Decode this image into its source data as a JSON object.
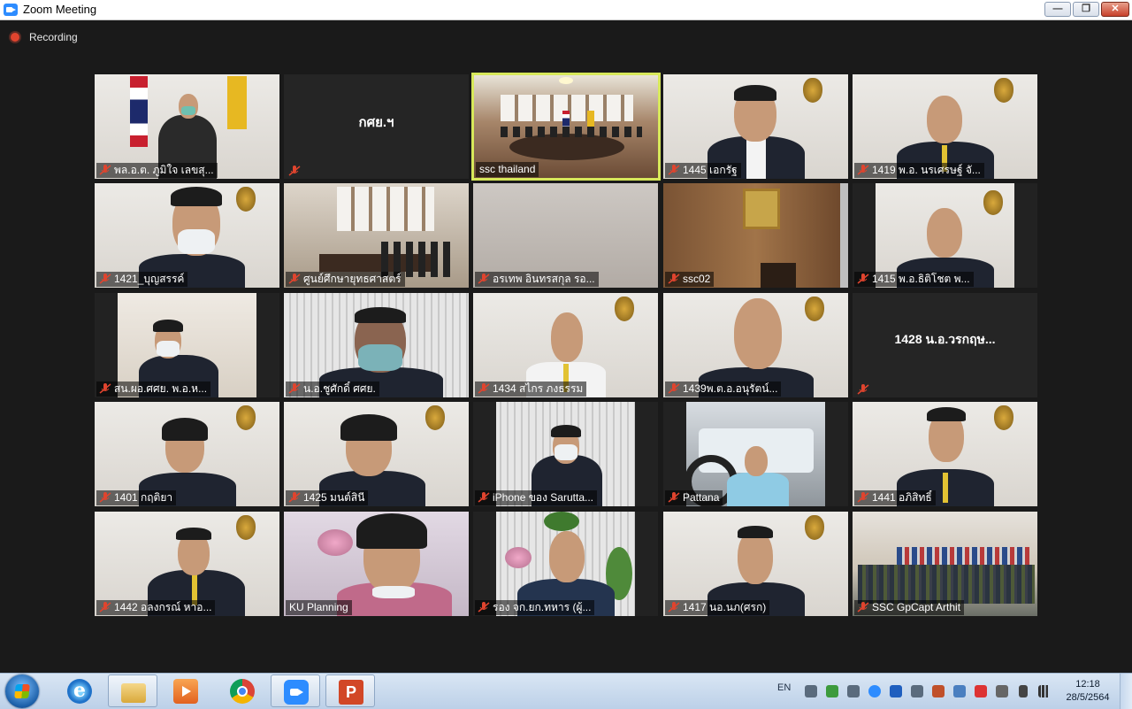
{
  "window": {
    "title": "Zoom Meeting",
    "min_glyph": "—",
    "max_glyph": "❐",
    "close_glyph": "✕"
  },
  "recording": {
    "label": "Recording"
  },
  "tiles": [
    {
      "name": "พล.อ.ต. ภูมิใจ  เลขสุ..."
    },
    {
      "name": "",
      "center_name": "กศย.ฯ"
    },
    {
      "name": "ssc thailand"
    },
    {
      "name": "1445 เอกรัฐ"
    },
    {
      "name": "1419 พ.อ. นรเศรษฐ์ จั..."
    },
    {
      "name": "1421_บุญสรรค์"
    },
    {
      "name": "ศูนย์ศึกษายุทธศาสตร์"
    },
    {
      "name": "อรเทพ อินทรสกุล รอ..."
    },
    {
      "name": "ssc02"
    },
    {
      "name": "1415 พ.อ.ธิติโชต พ..."
    },
    {
      "name": "สน.ผอ.ศศย. พ.อ.ห..."
    },
    {
      "name": "น.อ.ชูศักดิ์ ศศย."
    },
    {
      "name": "1434 สไกร ภงธรรม"
    },
    {
      "name": "1439พ.ต.อ.อนุรัตน์..."
    },
    {
      "name": "",
      "center_name": "1428 น.อ.วรกฤษ..."
    },
    {
      "name": "1401 กฤติยา"
    },
    {
      "name": "1425 มนต์สินี"
    },
    {
      "name": "iPhone ของ Sarutta..."
    },
    {
      "name": "Pattana"
    },
    {
      "name": "1441 อภิสิทธิ์"
    },
    {
      "name": "1442 อลงกรณ์ หาอ..."
    },
    {
      "name": "KU Planning"
    },
    {
      "name": "รอง จก.ยก.ทหาร (ผู้..."
    },
    {
      "name": "1417 นอ.นภ(ศรก)"
    },
    {
      "name": "SSC GpCapt Arthit"
    }
  ],
  "taskbar": {
    "language": "EN",
    "time": "12:18",
    "date": "28/5/2564",
    "apps": [
      "start-icon",
      "internet-explorer-icon",
      "file-explorer-icon",
      "media-player-icon",
      "chrome-icon",
      "zoom-icon",
      "powerpoint-icon"
    ]
  },
  "colors": {
    "active_speaker": "#d7e85a",
    "muted_mic": "#e0442e",
    "background": "#1a1a1a"
  }
}
